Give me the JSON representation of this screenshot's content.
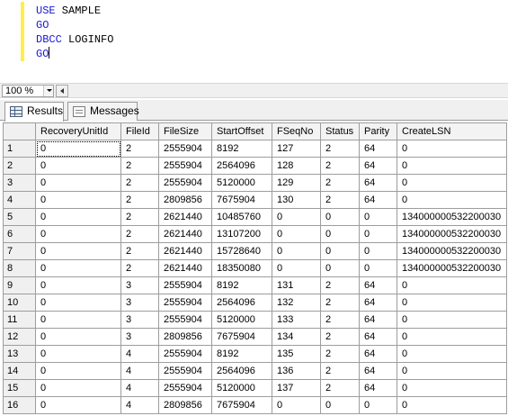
{
  "editor": {
    "lines": [
      {
        "keyword": "USE",
        "rest": " SAMPLE"
      },
      {
        "keyword": "GO",
        "rest": ""
      },
      {
        "keyword": "DBCC",
        "rest": " LOGINFO"
      },
      {
        "keyword": "GO",
        "rest": ""
      }
    ]
  },
  "zoom": {
    "value": "100 %"
  },
  "tabs": [
    {
      "label": "Results",
      "icon": "grid-icon"
    },
    {
      "label": "Messages",
      "icon": "messages-icon"
    }
  ],
  "grid": {
    "columns": [
      "RecoveryUnitId",
      "FileId",
      "FileSize",
      "StartOffset",
      "FSeqNo",
      "Status",
      "Parity",
      "CreateLSN"
    ],
    "rows": [
      [
        "1",
        "0",
        "2",
        "2555904",
        "8192",
        "127",
        "2",
        "64",
        "0"
      ],
      [
        "2",
        "0",
        "2",
        "2555904",
        "2564096",
        "128",
        "2",
        "64",
        "0"
      ],
      [
        "3",
        "0",
        "2",
        "2555904",
        "5120000",
        "129",
        "2",
        "64",
        "0"
      ],
      [
        "4",
        "0",
        "2",
        "2809856",
        "7675904",
        "130",
        "2",
        "64",
        "0"
      ],
      [
        "5",
        "0",
        "2",
        "2621440",
        "10485760",
        "0",
        "0",
        "0",
        "134000000532200030"
      ],
      [
        "6",
        "0",
        "2",
        "2621440",
        "13107200",
        "0",
        "0",
        "0",
        "134000000532200030"
      ],
      [
        "7",
        "0",
        "2",
        "2621440",
        "15728640",
        "0",
        "0",
        "0",
        "134000000532200030"
      ],
      [
        "8",
        "0",
        "2",
        "2621440",
        "18350080",
        "0",
        "0",
        "0",
        "134000000532200030"
      ],
      [
        "9",
        "0",
        "3",
        "2555904",
        "8192",
        "131",
        "2",
        "64",
        "0"
      ],
      [
        "10",
        "0",
        "3",
        "2555904",
        "2564096",
        "132",
        "2",
        "64",
        "0"
      ],
      [
        "11",
        "0",
        "3",
        "2555904",
        "5120000",
        "133",
        "2",
        "64",
        "0"
      ],
      [
        "12",
        "0",
        "3",
        "2809856",
        "7675904",
        "134",
        "2",
        "64",
        "0"
      ],
      [
        "13",
        "0",
        "4",
        "2555904",
        "8192",
        "135",
        "2",
        "64",
        "0"
      ],
      [
        "14",
        "0",
        "4",
        "2555904",
        "2564096",
        "136",
        "2",
        "64",
        "0"
      ],
      [
        "15",
        "0",
        "4",
        "2555904",
        "5120000",
        "137",
        "2",
        "64",
        "0"
      ],
      [
        "16",
        "0",
        "4",
        "2809856",
        "7675904",
        "0",
        "0",
        "0",
        "0"
      ]
    ]
  }
}
